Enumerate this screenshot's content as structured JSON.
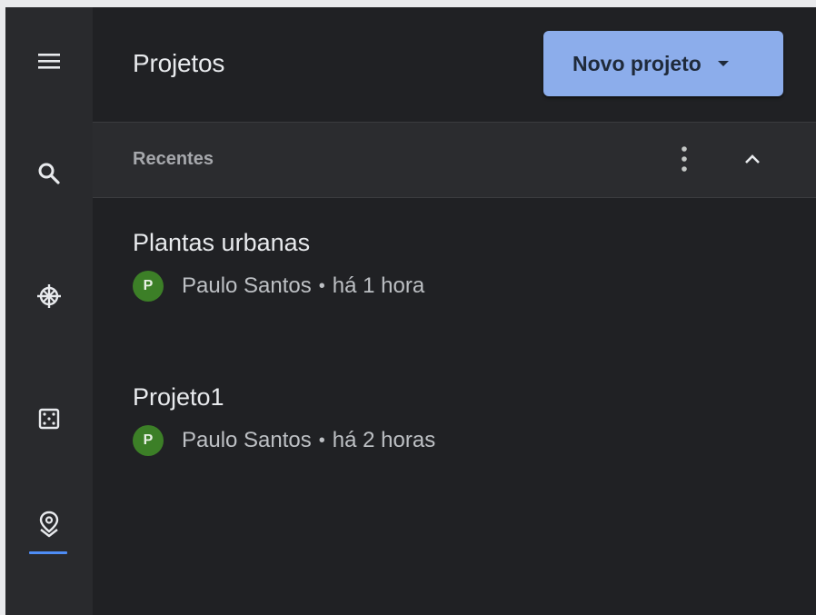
{
  "rail": {
    "items": [
      {
        "icon": "menu-icon"
      },
      {
        "icon": "search-icon"
      },
      {
        "icon": "globe-grid-icon"
      },
      {
        "icon": "dice-icon"
      },
      {
        "icon": "location-pin-icon",
        "active": true
      }
    ],
    "accent": "#4e8df6"
  },
  "header": {
    "title": "Projetos",
    "new_button_label": "Novo projeto",
    "new_button_color": "#8cadeb"
  },
  "section": {
    "title": "Recentes"
  },
  "projects": [
    {
      "name": "Plantas urbanas",
      "avatar": "P",
      "owner": "Paulo Santos",
      "separator": "•",
      "time": "há 1 hora"
    },
    {
      "name": "Projeto1",
      "avatar": "P",
      "owner": "Paulo Santos",
      "separator": "•",
      "time": "há 2 horas"
    }
  ]
}
